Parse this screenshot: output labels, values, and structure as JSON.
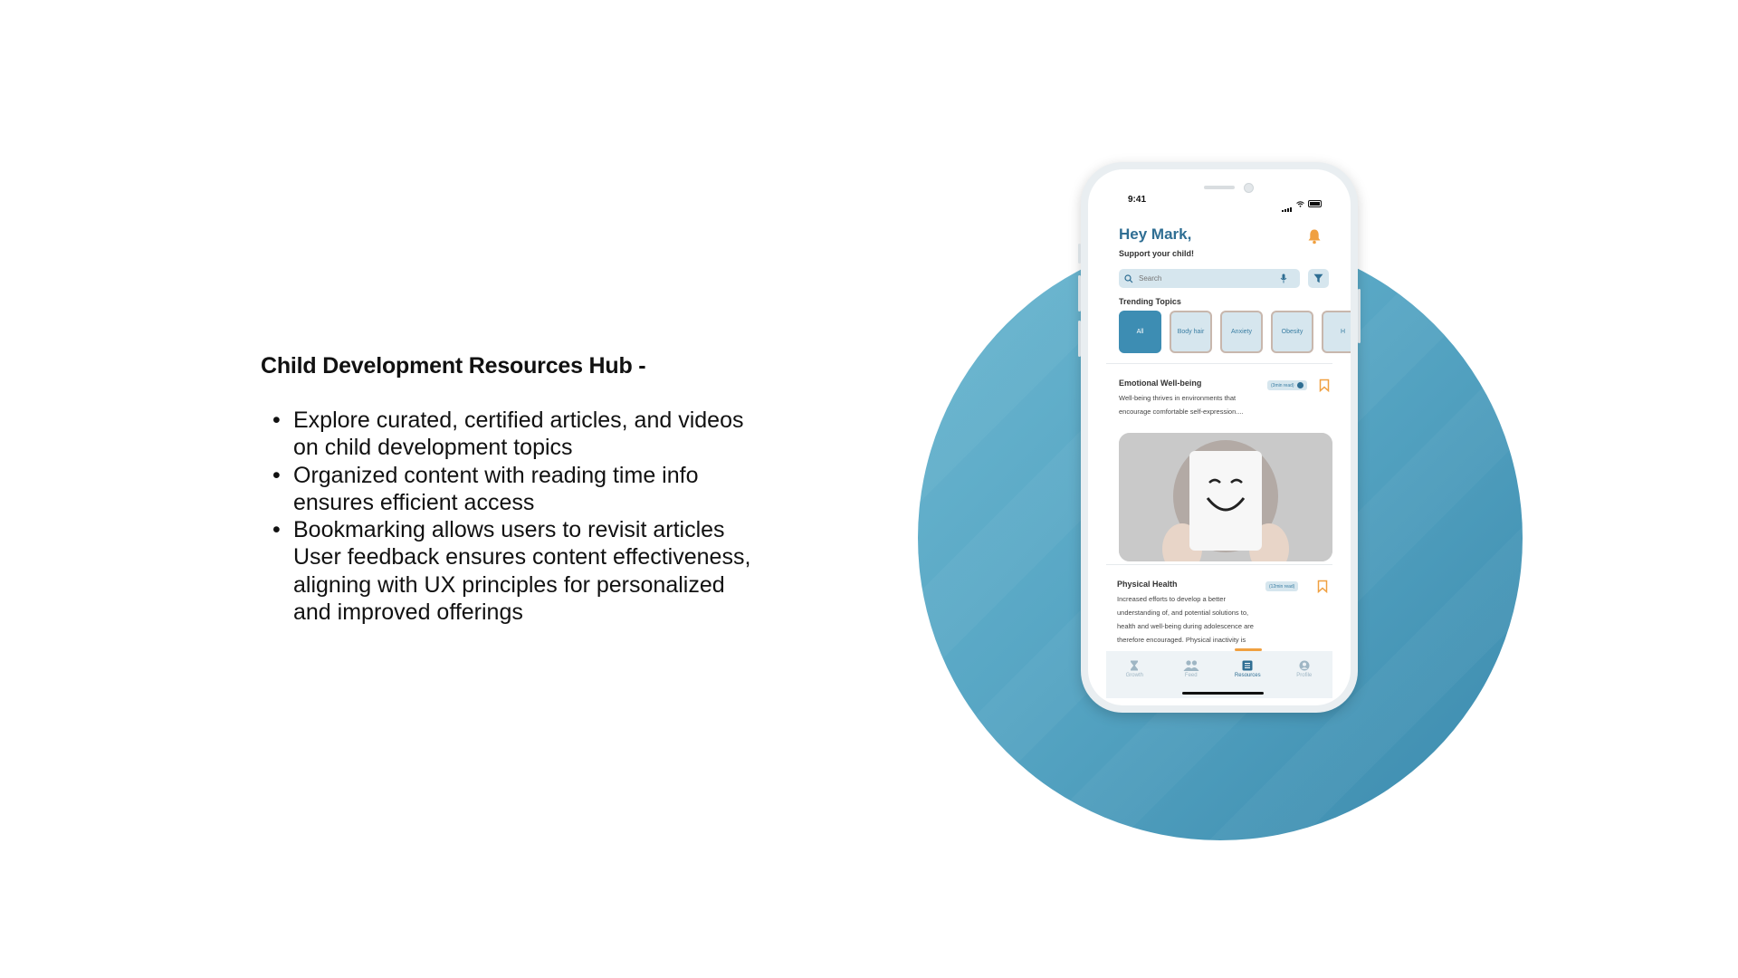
{
  "slide": {
    "heading": "Child Development Resources Hub -",
    "bullets": [
      [
        "Explore curated, certified articles, and videos",
        "on child development topics"
      ],
      [
        "Organized content with reading time info",
        "ensures efficient access"
      ],
      [
        "Bookmarking allows users to revisit articles",
        "User feedback ensures content effectiveness,",
        "aligning with UX principles for personalized",
        "and improved offerings"
      ]
    ],
    "bullet_glyph": "•"
  },
  "colors": {
    "accent": "#2f6e93",
    "circle": "#57a6c4",
    "chip_active": "#3d8db3",
    "bell": "#f0a040"
  },
  "phone": {
    "status": {
      "time": "9:41"
    },
    "header": {
      "greeting": "Hey Mark,",
      "subtitle": "Support your child!",
      "bell_icon": "bell-icon"
    },
    "search": {
      "placeholder": "Search",
      "search_icon": "search-icon",
      "mic_icon": "mic-icon",
      "filter_icon": "filter-icon"
    },
    "trending": {
      "title": "Trending Topics",
      "chips": [
        "All",
        "Body hair",
        "Anxiety",
        "Obesity",
        "H"
      ],
      "active": 0
    },
    "articles": [
      {
        "title": "Emotional Well-being",
        "read_time": "(3min read)",
        "body_lines": [
          "Well-being thrives in environments that",
          "encourage comfortable self-expression...."
        ],
        "bookmark_icon": "bookmark-icon"
      },
      {
        "title": "Physical Health",
        "read_time": "(12min read)",
        "body_lines": [
          "Increased efforts to develop a better",
          "understanding of, and potential solutions to,",
          "health and well-being during adolescence are",
          "therefore encouraged. Physical inactivity is"
        ],
        "bookmark_icon": "bookmark-icon"
      }
    ],
    "tabs": [
      {
        "label": "Growth",
        "icon": "hourglass-icon"
      },
      {
        "label": "Feed",
        "icon": "people-icon"
      },
      {
        "label": "Resources",
        "icon": "list-icon"
      },
      {
        "label": "Profile",
        "icon": "user-icon"
      }
    ],
    "active_tab": 2
  }
}
